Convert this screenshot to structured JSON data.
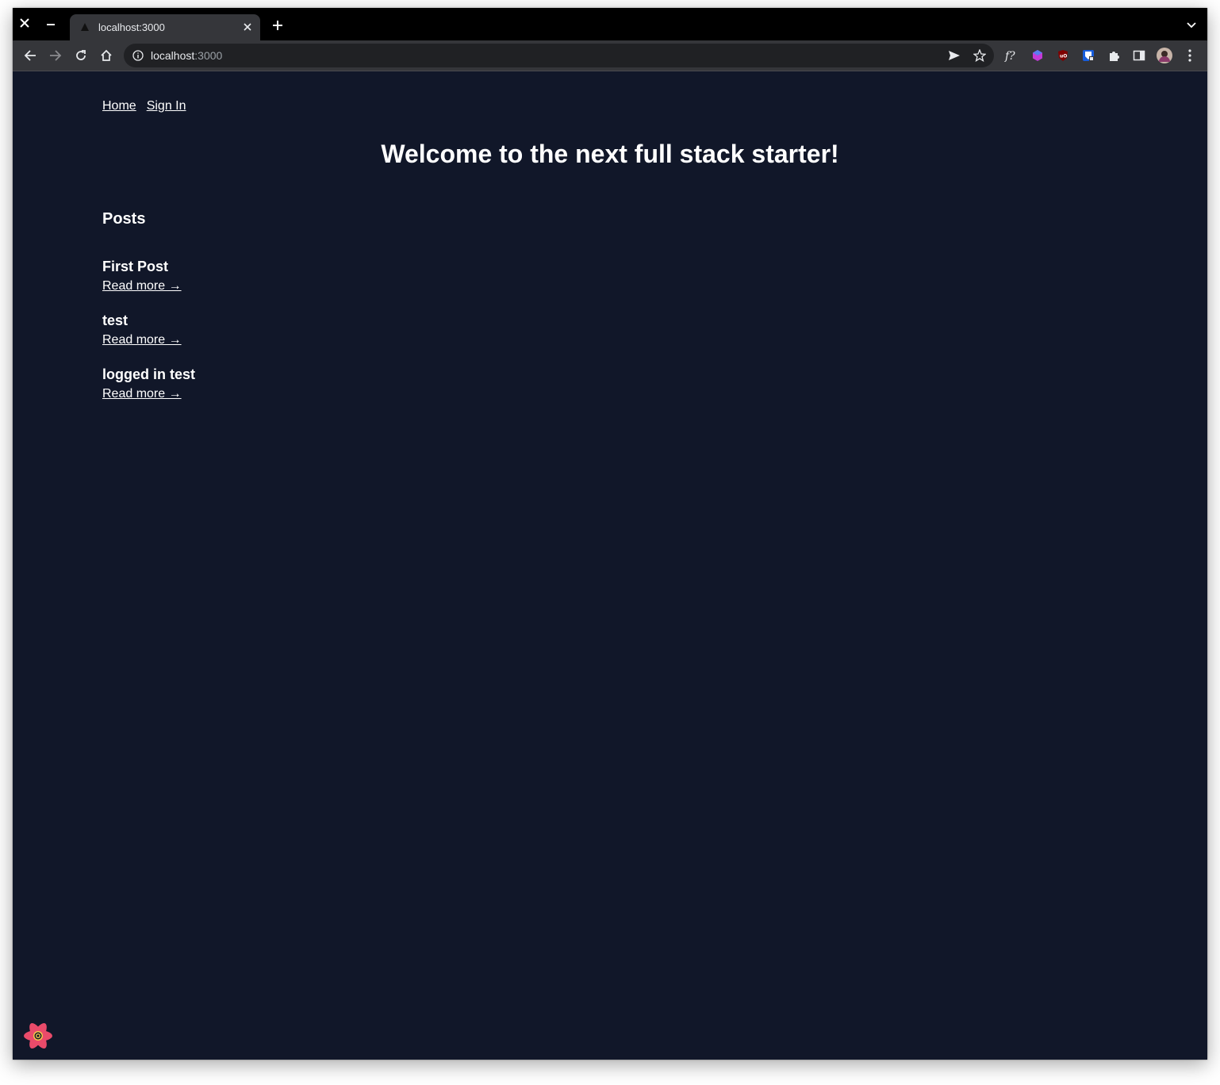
{
  "browser": {
    "tab_title": "localhost:3000",
    "url_host": "localhost",
    "url_port": ":3000"
  },
  "nav": {
    "home_label": "Home",
    "signin_label": "Sign In"
  },
  "hero": {
    "title": "Welcome to the next full stack starter!"
  },
  "posts": {
    "heading": "Posts",
    "items": [
      {
        "title": "First Post",
        "link": "Read more →"
      },
      {
        "title": "test",
        "link": "Read more →"
      },
      {
        "title": "logged in test",
        "link": "Read more →"
      }
    ]
  },
  "icons": {
    "window_close": "close-icon",
    "window_minimize": "minimize-icon",
    "extension_1": "formula-extension-icon",
    "extension_2": "cube-extension-icon",
    "extension_3": "ublock-extension-icon",
    "extension_4": "bitwarden-extension-icon",
    "devtools": "react-query-devtools-icon"
  },
  "colors": {
    "page_background": "#111729",
    "text": "#ffffff",
    "devtools_accent": "#e94b6a"
  }
}
